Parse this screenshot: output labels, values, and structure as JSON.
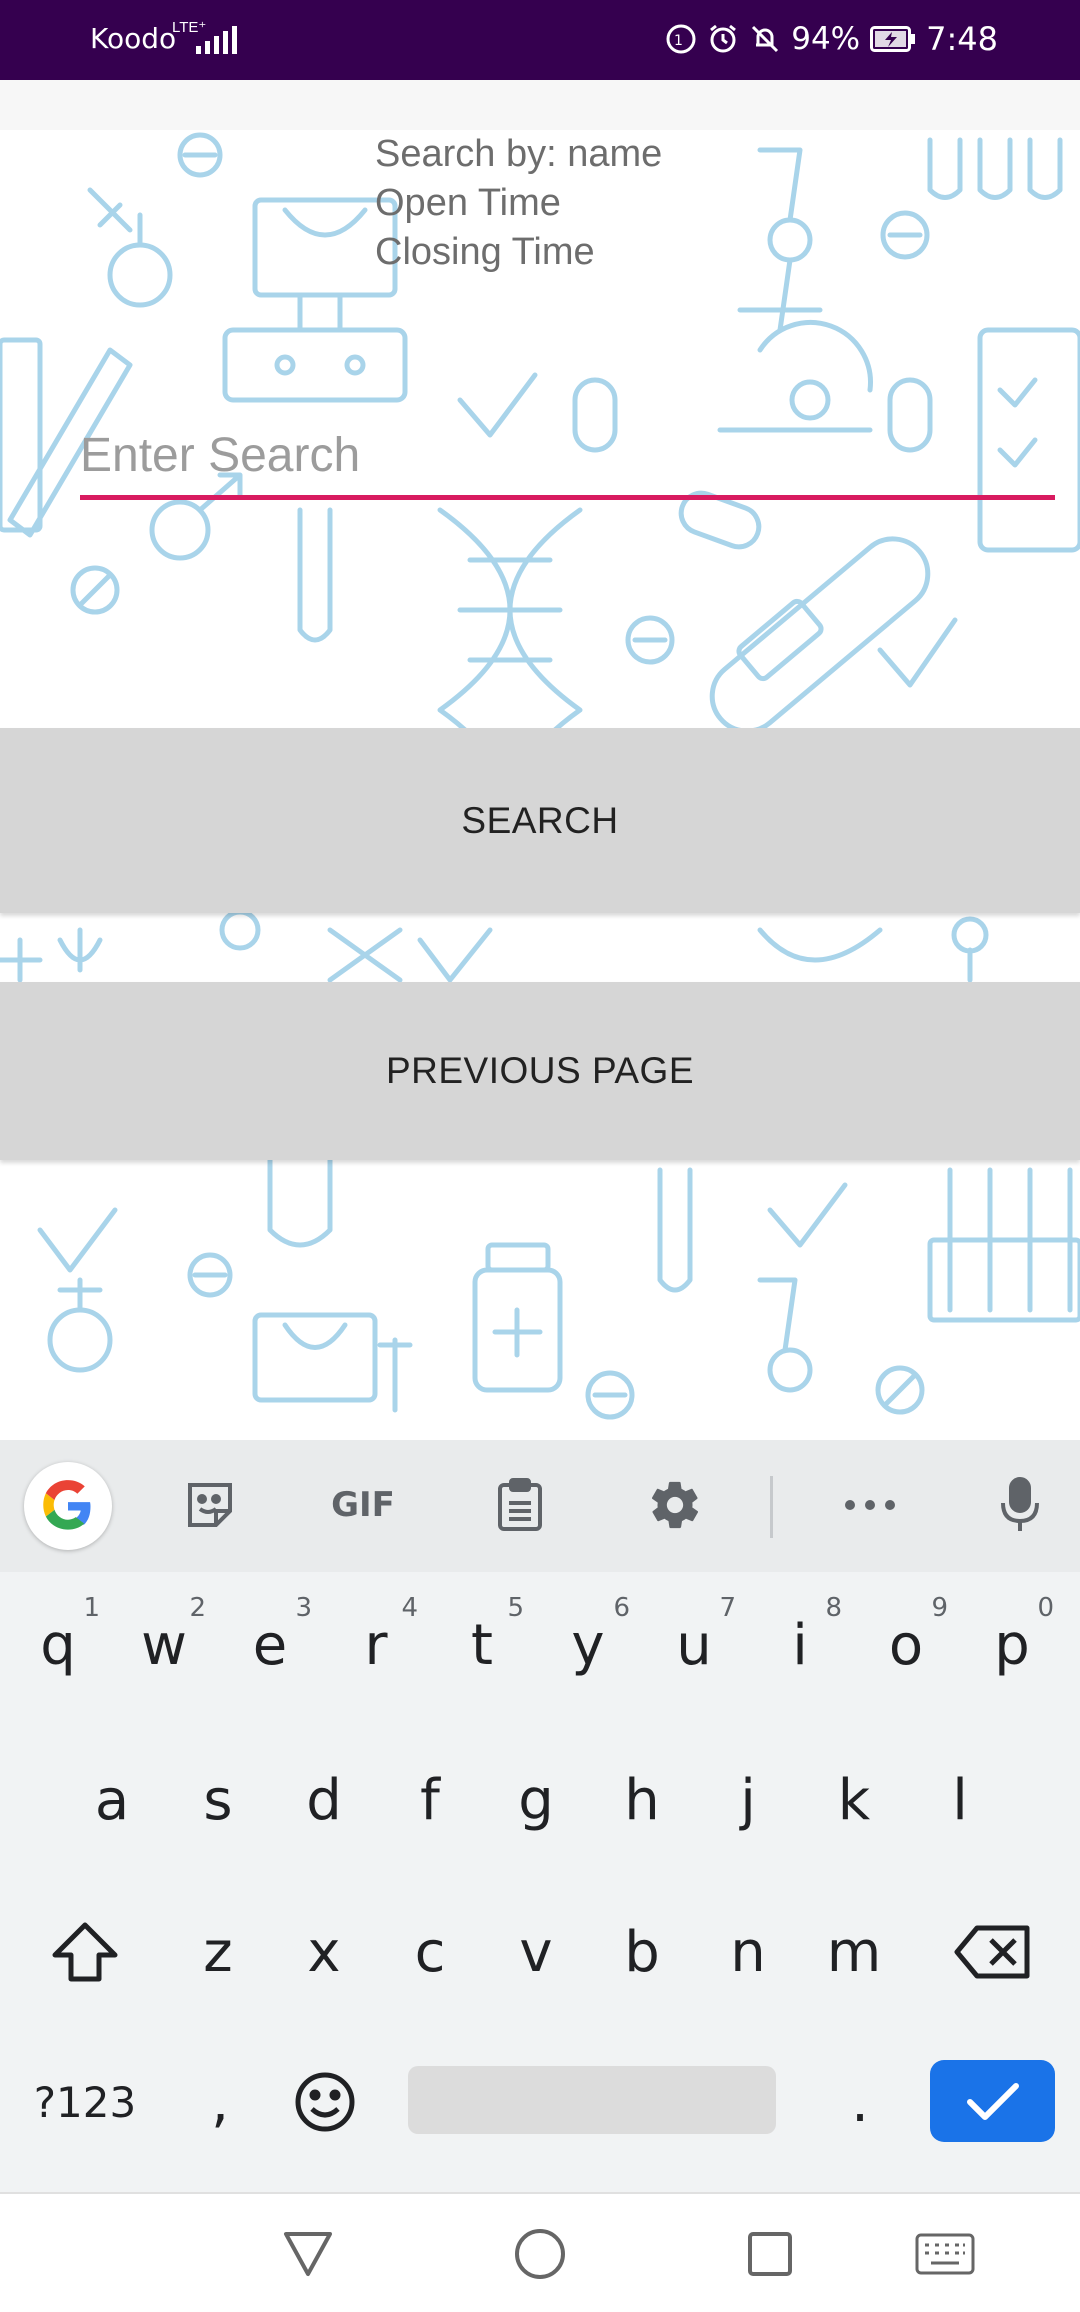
{
  "status_bar": {
    "carrier": "Koodo",
    "network": "LTE⁺",
    "battery_percent": "94%",
    "time": "7:48",
    "background": "#35004f"
  },
  "search_info": {
    "line1": "Search by: name",
    "line2": "Open Time",
    "line3": "Closing Time"
  },
  "search": {
    "placeholder": "Enter Search",
    "value": "",
    "accent": "#d81b60"
  },
  "buttons": {
    "search_label": "SEARCH",
    "previous_label": "PREVIOUS PAGE"
  },
  "keyboard": {
    "toolbar": {
      "gif_label": "GIF"
    },
    "row1": [
      {
        "letter": "q",
        "num": "1"
      },
      {
        "letter": "w",
        "num": "2"
      },
      {
        "letter": "e",
        "num": "3"
      },
      {
        "letter": "r",
        "num": "4"
      },
      {
        "letter": "t",
        "num": "5"
      },
      {
        "letter": "y",
        "num": "6"
      },
      {
        "letter": "u",
        "num": "7"
      },
      {
        "letter": "i",
        "num": "8"
      },
      {
        "letter": "o",
        "num": "9"
      },
      {
        "letter": "p",
        "num": "0"
      }
    ],
    "row2": [
      "a",
      "s",
      "d",
      "f",
      "g",
      "h",
      "j",
      "k",
      "l"
    ],
    "row3": [
      "z",
      "x",
      "c",
      "v",
      "b",
      "n",
      "m"
    ],
    "symbols_label": "?123",
    "comma": ",",
    "period": ".",
    "enter_color": "#1a73e8"
  }
}
